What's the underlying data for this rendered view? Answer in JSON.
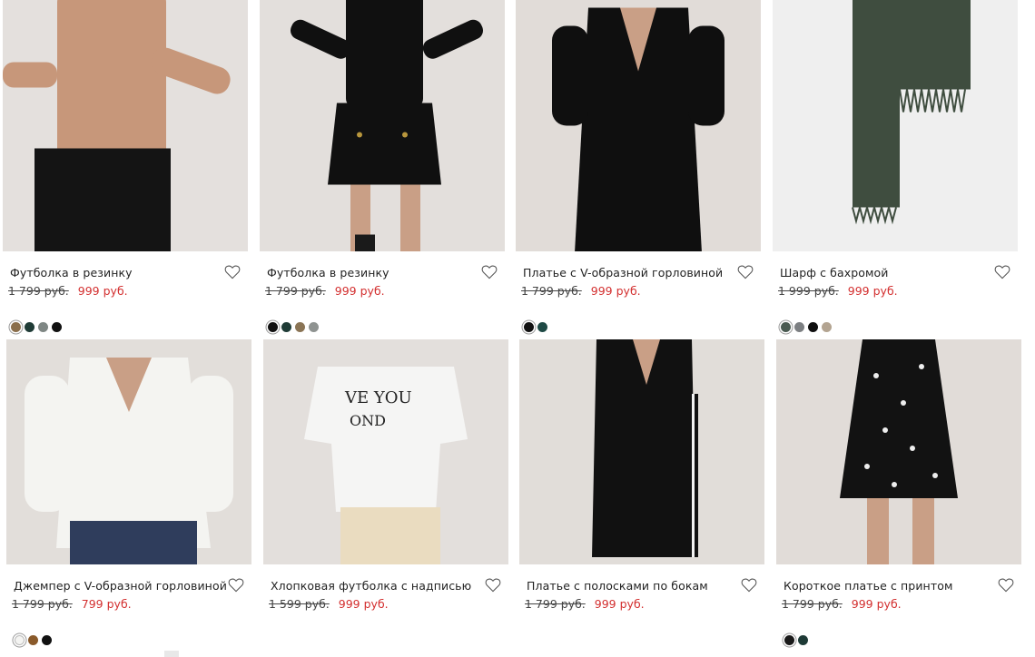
{
  "currency_label": "руб.",
  "products": [
    {
      "title": "Футболка в резинку",
      "old_price": "1 799 руб.",
      "new_price": "999 руб.",
      "swatches": [
        "#8a6e4b",
        "#1f3b36",
        "#7f8784",
        "#111111"
      ],
      "photo_bg": "#e4e0dd",
      "garment": "#c7977a"
    },
    {
      "title": "Футболка в резинку",
      "old_price": "1 799 руб.",
      "new_price": "999 руб.",
      "swatches": [
        "#111111",
        "#1f3b36",
        "#8a7455",
        "#8f9391"
      ],
      "photo_bg": "#e3dfdc",
      "garment": "#101010"
    },
    {
      "title": "Платье с V-образной горловиной",
      "old_price": "1 799 руб.",
      "new_price": "999 руб.",
      "swatches": [
        "#111111",
        "#1f4a45"
      ],
      "photo_bg": "#e1dcd8",
      "garment": "#0f0f0f"
    },
    {
      "title": "Шарф с бахромой",
      "old_price": "1 999 руб.",
      "new_price": "999 руб.",
      "swatches": [
        "#4a5a51",
        "#7c7f82",
        "#0f0f0f",
        "#b3a491"
      ],
      "photo_bg": "#efefef",
      "garment": "#3f4d3f"
    },
    {
      "title": "Джемпер с V-образной горловиной",
      "old_price": "1 799 руб.",
      "new_price": "799 руб.",
      "swatches": [
        "#f4f4f2",
        "#8a5a2b",
        "#111111"
      ],
      "photo_bg": "#e2deda",
      "garment": "#f4f4f1"
    },
    {
      "title": "Хлопковая футболка с надписью",
      "old_price": "1 599 руб.",
      "new_price": "999 руб.",
      "swatches": [],
      "photo_bg": "#e3dfdc",
      "garment": "#f5f5f4"
    },
    {
      "title": "Платье с полосками по бокам",
      "old_price": "1 799 руб.",
      "new_price": "999 руб.",
      "swatches": [],
      "photo_bg": "#e1ddd9",
      "garment": "#111111"
    },
    {
      "title": "Короткое платье с принтом",
      "old_price": "1 799 руб.",
      "new_price": "999 руб.",
      "swatches": [
        "#1a1a1a",
        "#1e3a36"
      ],
      "photo_bg": "#e1dcd8",
      "garment": "#121212"
    }
  ],
  "colors": {
    "sale_price": "#d32f2f",
    "text": "#222222"
  },
  "icons": {
    "favorite": "heart-outline-icon"
  }
}
